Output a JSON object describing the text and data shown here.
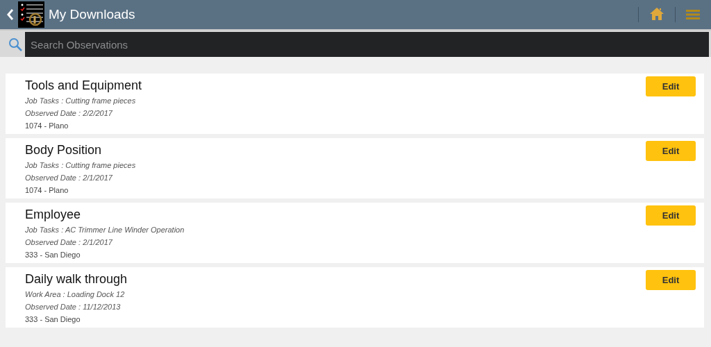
{
  "header": {
    "title": "My Downloads"
  },
  "search": {
    "placeholder": "Search Observations"
  },
  "observations": [
    {
      "title": "Tools and Equipment",
      "detail": "Job Tasks : Cutting frame pieces",
      "date": "Observed Date : 2/2/2017",
      "location": "1074 - Plano",
      "button": "Edit"
    },
    {
      "title": "Body Position",
      "detail": "Job Tasks : Cutting frame pieces",
      "date": "Observed Date : 2/1/2017",
      "location": "1074 - Plano",
      "button": "Edit"
    },
    {
      "title": "Employee",
      "detail": "Job Tasks : AC Trimmer Line Winder Operation",
      "date": "Observed Date : 2/1/2017",
      "location": "333 - San Diego",
      "button": "Edit"
    },
    {
      "title": "Daily walk through",
      "detail": "Work Area : Loading Dock 12",
      "date": "Observed Date : 11/12/2013",
      "location": "333 - San Diego",
      "button": "Edit"
    }
  ]
}
